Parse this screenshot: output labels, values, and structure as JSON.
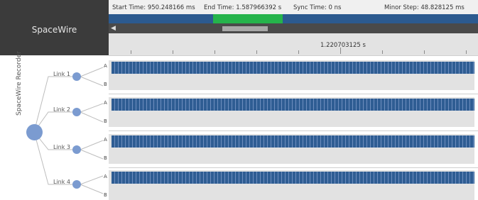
{
  "app": {
    "title": "SpaceWire"
  },
  "info_bar": {
    "start_time": "Start Time: 950.248166 ms",
    "end_time": "End Time: 1.587966392 s",
    "sync_time": "Sync Time: 0 ns",
    "minor_step": "Minor Step: 48.828125 ms"
  },
  "ruler": {
    "center_label": "1.220703125 s"
  },
  "tree": {
    "root_label": "SpaceWire Recorder",
    "links": [
      {
        "label": "Link 1",
        "a": "A",
        "b": "B"
      },
      {
        "label": "Link 2",
        "a": "A",
        "b": "B"
      },
      {
        "label": "Link 3",
        "a": "A",
        "b": "B"
      },
      {
        "label": "Link 4",
        "a": "A",
        "b": "B"
      }
    ]
  },
  "colors": {
    "header_bg": "#3b3b3b",
    "overview_bar": "#2c5a8f",
    "overview_selection": "#25b34b",
    "signal_fill": "#2f5d93",
    "node_fill": "#7b9bd0"
  },
  "icons": {
    "scroll_left": "triangle-left-icon"
  }
}
